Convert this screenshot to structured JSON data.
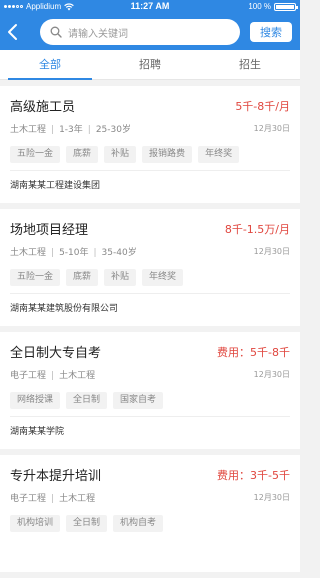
{
  "status_bar": {
    "carrier": "Applidium",
    "time": "11:27 AM",
    "battery": "100 %"
  },
  "search": {
    "placeholder": "请输入关键词",
    "button_label": "搜索"
  },
  "tabs": [
    {
      "label": "全部",
      "active": true
    },
    {
      "label": "招聘",
      "active": false
    },
    {
      "label": "招生",
      "active": false
    }
  ],
  "cards": [
    {
      "title": "高级施工员",
      "salary": "5千-8千/月",
      "meta": [
        "土木工程",
        "1-3年",
        "25-30岁"
      ],
      "date": "12月30日",
      "tags": [
        "五险一金",
        "底薪",
        "补贴",
        "报销路费",
        "年终奖"
      ],
      "company": "湖南某某工程建设集团"
    },
    {
      "title": "场地项目经理",
      "salary": "8千-1.5万/月",
      "meta": [
        "土木工程",
        "5-10年",
        "35-40岁"
      ],
      "date": "12月30日",
      "tags": [
        "五险一金",
        "底薪",
        "补贴",
        "年终奖"
      ],
      "company": "湖南某某建筑股份有限公司"
    },
    {
      "title": "全日制大专自考",
      "salary": "费用：5千-8千",
      "meta": [
        "电子工程",
        "土木工程"
      ],
      "date": "12月30日",
      "tags": [
        "网络授课",
        "全日制",
        "国家自考"
      ],
      "company": "湖南某某学院"
    },
    {
      "title": "专升本提升培训",
      "salary": "费用：3千-5千",
      "meta": [
        "电子工程",
        "土木工程"
      ],
      "date": "12月30日",
      "tags": [
        "机构培训",
        "全日制",
        "机构自考"
      ],
      "company": ""
    }
  ],
  "colors": {
    "primary": "#2f88e3",
    "salary": "#e0463e"
  }
}
